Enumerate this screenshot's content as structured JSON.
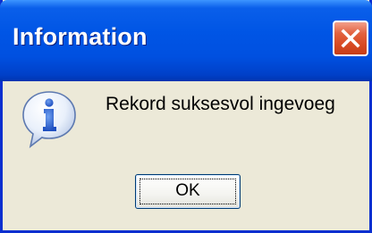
{
  "dialog": {
    "title": "Information",
    "message": "Rekord suksesvol ingevoeg",
    "ok_label": "OK",
    "icon": "information-icon",
    "close_icon": "close-icon"
  },
  "colors": {
    "title_bar": "#0055e5",
    "close_button": "#d84a22",
    "dialog_background": "#ece9d8",
    "info_icon": "#2a62d6"
  }
}
